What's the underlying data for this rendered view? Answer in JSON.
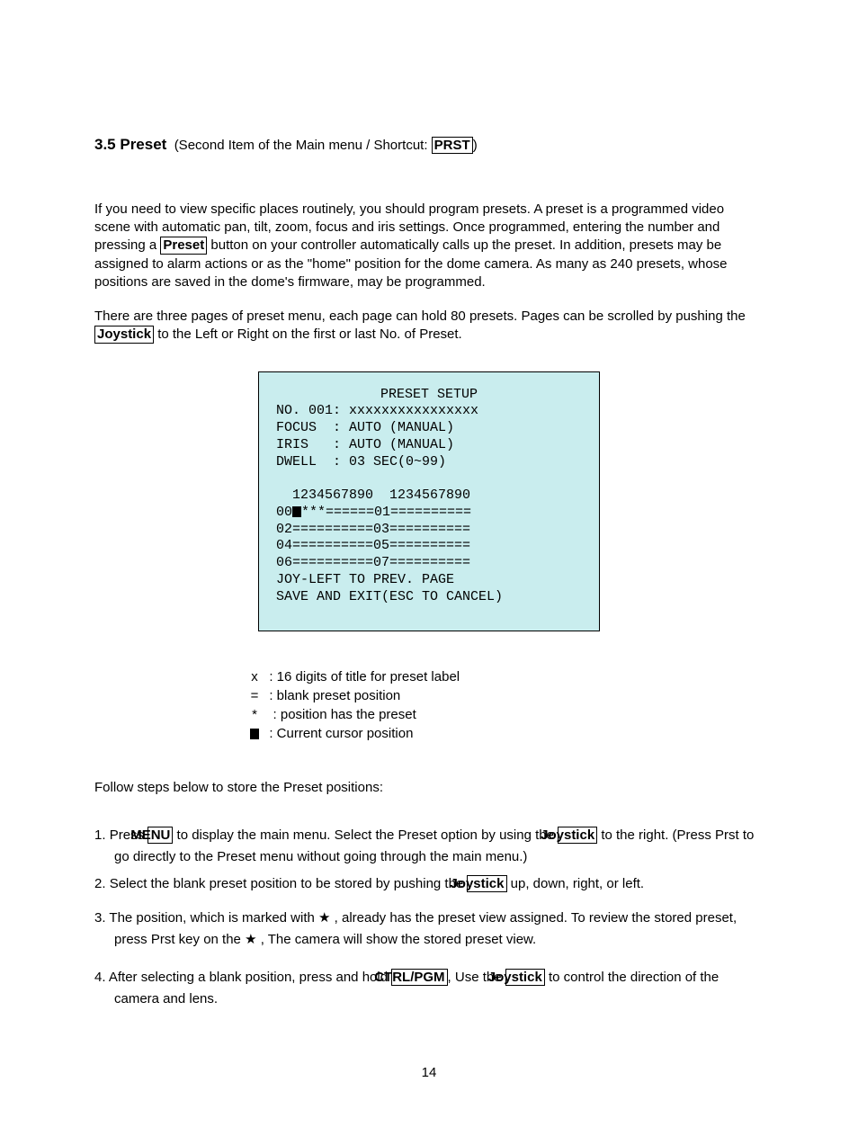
{
  "heading": {
    "number_title": "3.5 Preset",
    "subtitle_pre": "(Second Item of the Main menu / Shortcut: ",
    "shortcut": "PRST",
    "subtitle_post": ")"
  },
  "para1": {
    "t1": "If you need to view specific places routinely, you should program presets. A preset is a programmed video scene with automatic pan, tilt, zoom, focus and iris settings. Once programmed, entering the number and pressing a ",
    "btn": "Preset",
    "t2": " button on your controller automatically calls up the preset. In addition, presets may be assigned to alarm actions or as the \"home\" position for the dome camera. As many as 240 presets, whose positions are saved in the dome's firmware, may be programmed."
  },
  "para2": {
    "t1": "There are three pages of preset menu, each page can hold 80 presets. Pages can be scrolled by pushing the ",
    "btn": "Joystick",
    "t2": " to the Left or Right on the first or last No. of Preset."
  },
  "osd": {
    "title": "PRESET SETUP",
    "l1": " NO. 001: xxxxxxxxxxxxxxxx",
    "l2": " FOCUS  : AUTO (MANUAL)",
    "l3": " IRIS   : AUTO (MANUAL)",
    "l4": " DWELL  : 03 SEC(0~99)",
    "l5": "",
    "l6": "   1234567890  1234567890",
    "l7a": " 00",
    "l7b": "***======01==========",
    "l8": " 02==========03==========",
    "l9": " 04==========05==========",
    "l10": " 06==========07==========",
    "l11": " JOY-LEFT TO PREV. PAGE",
    "l12": " SAVE AND EXIT(ESC TO CANCEL)"
  },
  "legend": {
    "x": ": 16 digits of title for preset label",
    "eq": ": blank preset position",
    "star": ": position has the preset",
    "blk": ": Current cursor position"
  },
  "follow": "Follow steps below to store the Preset positions:",
  "steps": {
    "s1a": "Press ",
    "s1_menu": "MENU",
    "s1b": " to display the main menu. Select the Preset option by using the ",
    "s1_joy": "Joystick",
    "s1c": " to the right. (Press Prst to go directly to the Preset menu without going through the main menu.)",
    "s2a": "Select the blank preset position to be stored by pushing the ",
    "s2_joy": "Joystick",
    "s2b": " up, down, right, or left.",
    "s3a": "The position, which is marked with ",
    "s3b": " , already has the preset view assigned. To review the stored preset, press Prst key on the ",
    "s3c": " ,  The camera will show the stored preset view.",
    "s4a": "After selecting a blank position, press and hold ",
    "s4_ctrl": "CTRL/PGM",
    "s4b": ", Use the ",
    "s4_joy": "Joystick",
    "s4c": " to control the direction of the camera and lens."
  },
  "pagenum": "14"
}
